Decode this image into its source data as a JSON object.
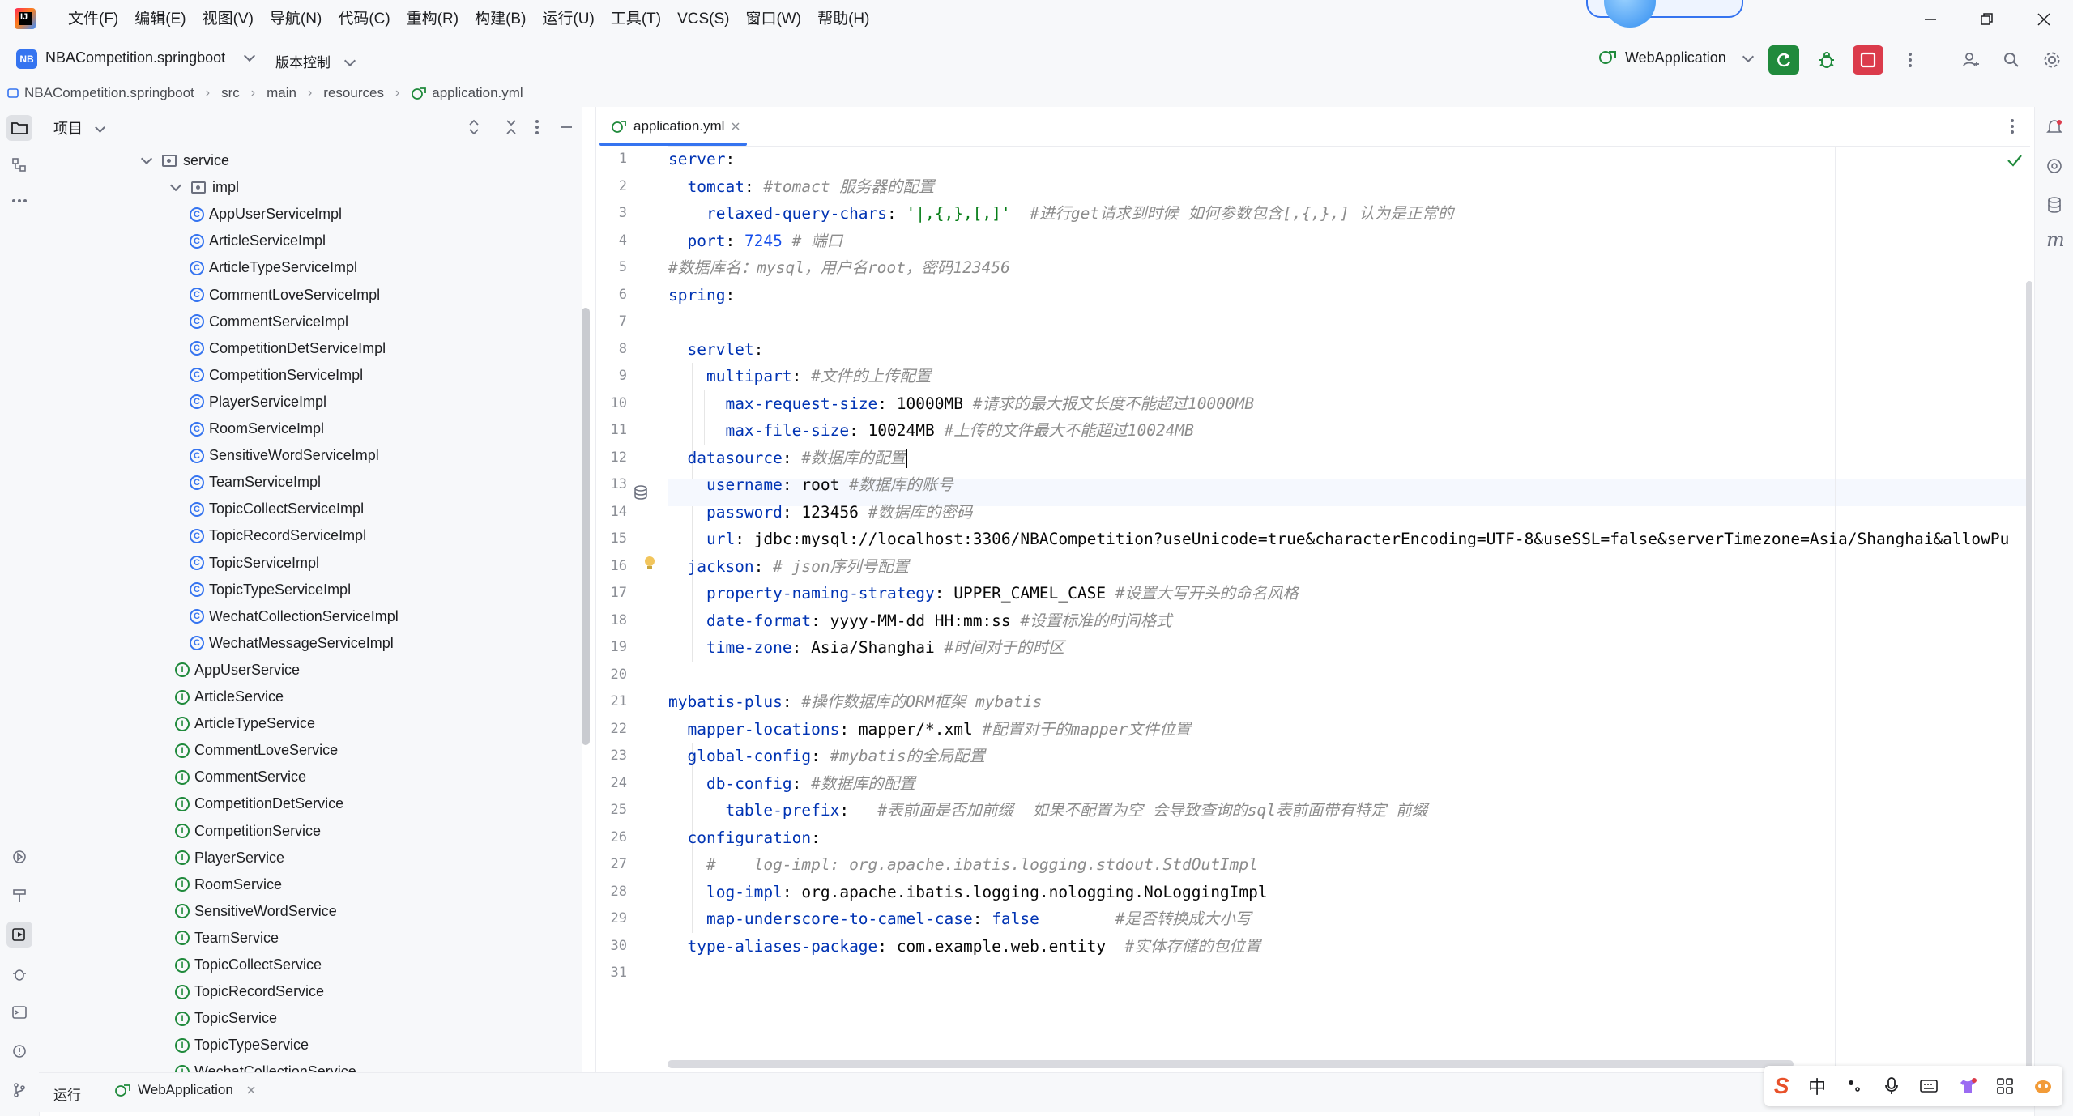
{
  "menu": [
    "文件(F)",
    "编辑(E)",
    "视图(V)",
    "导航(N)",
    "代码(C)",
    "重构(R)",
    "构建(B)",
    "运行(U)",
    "工具(T)",
    "VCS(S)",
    "窗口(W)",
    "帮助(H)"
  ],
  "toolbar": {
    "project_badge": "NB",
    "project_name": "NBACompetition.springboot",
    "vcs_label": "版本控制",
    "run_config": "WebApplication"
  },
  "breadcrumb": [
    "NBACompetition.springboot",
    "src",
    "main",
    "resources",
    "application.yml"
  ],
  "project_panel": {
    "title": "项目",
    "rows": [
      {
        "label": "service",
        "kind": "folder"
      },
      {
        "label": "impl",
        "kind": "folder"
      },
      {
        "label": "AppUserServiceImpl",
        "kind": "class"
      },
      {
        "label": "ArticleServiceImpl",
        "kind": "class"
      },
      {
        "label": "ArticleTypeServiceImpl",
        "kind": "class"
      },
      {
        "label": "CommentLoveServiceImpl",
        "kind": "class"
      },
      {
        "label": "CommentServiceImpl",
        "kind": "class"
      },
      {
        "label": "CompetitionDetServiceImpl",
        "kind": "class"
      },
      {
        "label": "CompetitionServiceImpl",
        "kind": "class"
      },
      {
        "label": "PlayerServiceImpl",
        "kind": "class"
      },
      {
        "label": "RoomServiceImpl",
        "kind": "class"
      },
      {
        "label": "SensitiveWordServiceImpl",
        "kind": "class"
      },
      {
        "label": "TeamServiceImpl",
        "kind": "class"
      },
      {
        "label": "TopicCollectServiceImpl",
        "kind": "class"
      },
      {
        "label": "TopicRecordServiceImpl",
        "kind": "class"
      },
      {
        "label": "TopicServiceImpl",
        "kind": "class"
      },
      {
        "label": "TopicTypeServiceImpl",
        "kind": "class"
      },
      {
        "label": "WechatCollectionServiceImpl",
        "kind": "class"
      },
      {
        "label": "WechatMessageServiceImpl",
        "kind": "class"
      },
      {
        "label": "AppUserService",
        "kind": "interface"
      },
      {
        "label": "ArticleService",
        "kind": "interface"
      },
      {
        "label": "ArticleTypeService",
        "kind": "interface"
      },
      {
        "label": "CommentLoveService",
        "kind": "interface"
      },
      {
        "label": "CommentService",
        "kind": "interface"
      },
      {
        "label": "CompetitionDetService",
        "kind": "interface"
      },
      {
        "label": "CompetitionService",
        "kind": "interface"
      },
      {
        "label": "PlayerService",
        "kind": "interface"
      },
      {
        "label": "RoomService",
        "kind": "interface"
      },
      {
        "label": "SensitiveWordService",
        "kind": "interface"
      },
      {
        "label": "TeamService",
        "kind": "interface"
      },
      {
        "label": "TopicCollectService",
        "kind": "interface"
      },
      {
        "label": "TopicRecordService",
        "kind": "interface"
      },
      {
        "label": "TopicService",
        "kind": "interface"
      },
      {
        "label": "TopicTypeService",
        "kind": "interface"
      },
      {
        "label": "WechatCollectionService",
        "kind": "interface"
      }
    ]
  },
  "editor": {
    "tab_label": "application.yml",
    "line_numbers": [
      "1",
      "2",
      "3",
      "4",
      "5",
      "6",
      "7",
      "8",
      "9",
      "10",
      "11",
      "12",
      "13",
      "14",
      "15",
      "16",
      "17",
      "18",
      "19",
      "20",
      "21",
      "22",
      "23",
      "24",
      "25",
      "26",
      "27",
      "28",
      "29",
      "30",
      "31"
    ],
    "lines": [
      {
        "key": "server",
        "sep": ":"
      },
      {
        "indent": "  ",
        "key": "tomcat",
        "sep": ":",
        "comment": " #tomact 服务器的配置"
      },
      {
        "indent": "    ",
        "key": "relaxed-query-chars",
        "sep": ": ",
        "str": "'|,{,},[,]'",
        "comment": "  #进行get请求到时候 如何参数包含[,{,},] 认为是正常的"
      },
      {
        "indent": "  ",
        "key": "port",
        "sep": ": ",
        "num": "7245",
        "comment": " # 端口"
      },
      {
        "comment": "#数据库名：mysql，用户名root，密码123456"
      },
      {
        "key": "spring",
        "sep": ":"
      },
      {},
      {
        "indent": "  ",
        "key": "servlet",
        "sep": ":"
      },
      {
        "indent": "    ",
        "key": "multipart",
        "sep": ":",
        "comment": " #文件的上传配置"
      },
      {
        "indent": "      ",
        "key": "max-request-size",
        "sep": ": ",
        "val": "10000MB",
        "comment": " #请求的最大报文长度不能超过10000MB"
      },
      {
        "indent": "      ",
        "key": "max-file-size",
        "sep": ": ",
        "val": "10024MB",
        "comment": " #上传的文件最大不能超过10024MB"
      },
      {
        "indent": "  ",
        "key": "datasource",
        "sep": ":",
        "comment": " #数据库的配置"
      },
      {
        "indent": "    ",
        "key": "username",
        "sep": ": ",
        "val": "root",
        "comment": " #数据库的账号"
      },
      {
        "indent": "    ",
        "key": "password",
        "sep": ": ",
        "val": "123456",
        "comment": " #数据库的密码"
      },
      {
        "indent": "    ",
        "key": "url",
        "sep": ": ",
        "val": "jdbc:mysql://localhost:3306/NBACompetition?useUnicode=true&characterEncoding=UTF-8&useSSL=false&serverTimezone=Asia/Shanghai&allowPu"
      },
      {
        "indent": "  ",
        "key": "jackson",
        "sep": ":",
        "comment": " # json序列号配置"
      },
      {
        "indent": "    ",
        "key": "property-naming-strategy",
        "sep": ": ",
        "val": "UPPER_CAMEL_CASE",
        "comment": " #设置大写开头的命名风格"
      },
      {
        "indent": "    ",
        "key": "date-format",
        "sep": ": ",
        "val": "yyyy-MM-dd HH:mm:ss",
        "comment": " #设置标准的时间格式"
      },
      {
        "indent": "    ",
        "key": "time-zone",
        "sep": ": ",
        "val": "Asia/Shanghai",
        "comment": " #时间对于的时区"
      },
      {},
      {
        "key": "mybatis-plus",
        "sep": ":",
        "comment": " #操作数据库的ORM框架 mybatis"
      },
      {
        "indent": "  ",
        "key": "mapper-locations",
        "sep": ": ",
        "val": "mapper/*.xml",
        "comment": " #配置对于的mapper文件位置"
      },
      {
        "indent": "  ",
        "key": "global-config",
        "sep": ":",
        "comment": " #mybatis的全局配置"
      },
      {
        "indent": "    ",
        "key": "db-config",
        "sep": ":",
        "comment": " #数据库的配置"
      },
      {
        "indent": "      ",
        "key": "table-prefix",
        "sep": ":",
        "comment": "   #表前面是否加前缀  如果不配置为空 会导致查询的sql表前面带有特定 前缀"
      },
      {
        "indent": "  ",
        "key": "configuration",
        "sep": ":"
      },
      {
        "indent": "    ",
        "comment": "#    log-impl: org.apache.ibatis.logging.stdout.StdOutImpl"
      },
      {
        "indent": "    ",
        "key": "log-impl",
        "sep": ": ",
        "val": "org.apache.ibatis.logging.nologging.NoLoggingImpl"
      },
      {
        "indent": "    ",
        "key": "map-underscore-to-camel-case",
        "sep": ": ",
        "bool": "false",
        "comment": "        #是否转换成大小写"
      },
      {
        "indent": "  ",
        "key": "type-aliases-package",
        "sep": ": ",
        "val": "com.example.web.entity",
        "comment": "  #实体存储的包位置"
      },
      {}
    ]
  },
  "bottom": {
    "run_label": "运行",
    "run_tab": "WebApplication"
  },
  "ime": {
    "lang": "中"
  }
}
